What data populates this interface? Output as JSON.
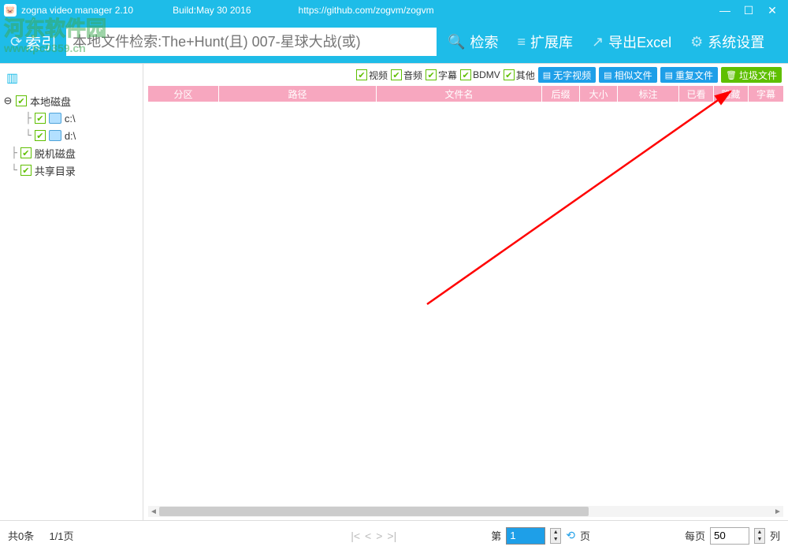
{
  "titlebar": {
    "app_name": "zogna video manager 2.10",
    "build": "Build:May 30 2016",
    "url": "https://github.com/zogvm/zogvm"
  },
  "watermark": {
    "text": "河东软件园",
    "url": "www.pc0359.cn"
  },
  "toolbar": {
    "index_btn": "索引",
    "search_placeholder": "本地文件检索:The+Hunt(且) 007-星球大战(或)",
    "search_btn": "检索",
    "extlib_btn": "扩展库",
    "export_btn": "导出Excel",
    "settings_btn": "系统设置"
  },
  "sidebar": {
    "items": [
      {
        "label": "本地磁盘",
        "level": 1,
        "expanded": true,
        "hasFolder": false
      },
      {
        "label": "c:\\",
        "level": 2,
        "hasFolder": true
      },
      {
        "label": "d:\\",
        "level": 2,
        "hasFolder": true
      },
      {
        "label": "脱机磁盘",
        "level": 1,
        "hasFolder": false
      },
      {
        "label": "共享目录",
        "level": 1,
        "hasFolder": false
      }
    ]
  },
  "filters": {
    "video": "视频",
    "audio": "音频",
    "subtitle": "字幕",
    "bdmv": "BDMV",
    "other": "其他",
    "nosub": "无字视频",
    "similar": "相似文件",
    "dup": "重复文件",
    "trash": "垃圾文件"
  },
  "columns": {
    "partition": "分区",
    "path": "路径",
    "filename": "文件名",
    "ext": "后缀",
    "size": "大小",
    "note": "标注",
    "seen": "已看",
    "hide": "隐藏",
    "sub": "字幕"
  },
  "footer": {
    "total": "共0条",
    "pages": "1/1页",
    "page_label_pre": "第",
    "page_value": "1",
    "page_label_suf": "页",
    "perpage_label_pre": "每页",
    "perpage_value": "50",
    "perpage_label_suf": "列"
  }
}
